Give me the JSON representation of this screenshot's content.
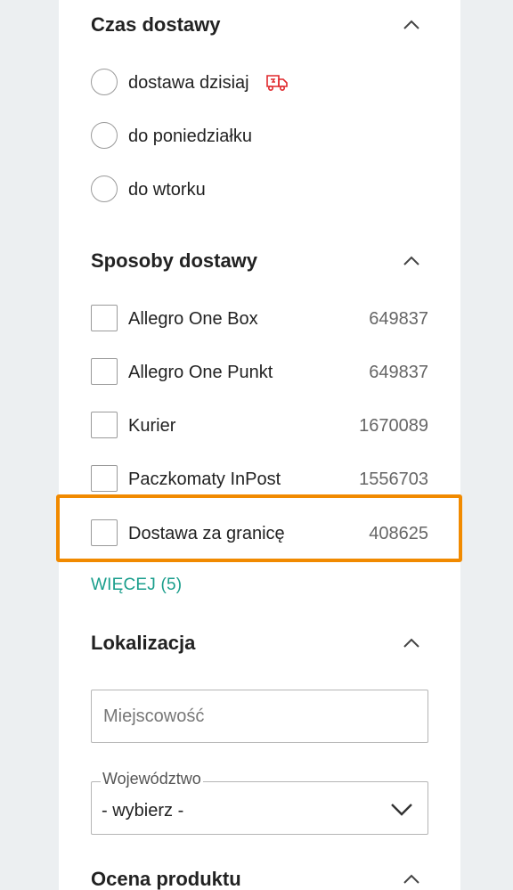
{
  "delivery_time": {
    "title": "Czas dostawy",
    "options": [
      {
        "label": "dostawa dzisiaj",
        "icon": "delivery-truck-icon"
      },
      {
        "label": "do poniedziałku"
      },
      {
        "label": "do wtorku"
      }
    ]
  },
  "delivery_methods": {
    "title": "Sposoby dostawy",
    "options": [
      {
        "label": "Allegro One Box",
        "count": "649837"
      },
      {
        "label": "Allegro One Punkt",
        "count": "649837"
      },
      {
        "label": "Kurier",
        "count": "1670089"
      },
      {
        "label": "Paczkomaty InPost",
        "count": "1556703"
      },
      {
        "label": "Dostawa za granicę",
        "count": "408625"
      }
    ],
    "more_label": "WIĘCEJ (5)"
  },
  "location": {
    "title": "Lokalizacja",
    "city_placeholder": "Miejscowość",
    "region_label": "Województwo",
    "region_value": "- wybierz -"
  },
  "rating": {
    "title": "Ocena produktu"
  },
  "colors": {
    "accent_link": "#1a9e8c",
    "highlight": "#f18a00",
    "truck_icon": "#e0282c"
  }
}
